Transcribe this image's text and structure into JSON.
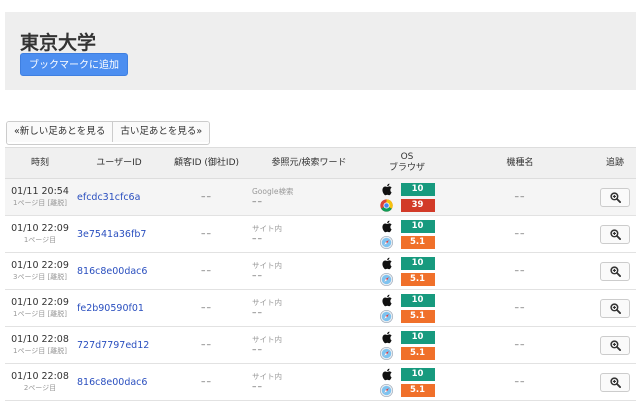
{
  "header": {
    "title": "東京大学",
    "bookmark_label": "ブックマークに追加"
  },
  "pager": {
    "newer_label": "«新しい足あとを見る",
    "older_label": "古い足あとを見る»"
  },
  "table": {
    "headers": {
      "time": "時刻",
      "user_id": "ユーザーID",
      "customer_id": "顧客ID (御社ID)",
      "referrer": "参照元/検索ワード",
      "os": "OS",
      "browser": "ブラウザ",
      "model": "機種名",
      "track": "追跡"
    },
    "rows": [
      {
        "time": "01/11 20:54",
        "visit": "1ページ目 [離脱]",
        "user_id": "efcdc31cfc6a",
        "customer_id": "––",
        "ref_label": "Google検索",
        "ref_value": "––",
        "os_icon": "apple-icon",
        "os_version": "10",
        "browser_icon": "chrome-icon",
        "browser_version": "39",
        "model": "––"
      },
      {
        "time": "01/10 22:09",
        "visit": "1ページ目",
        "user_id": "3e7541a36fb7",
        "customer_id": "––",
        "ref_label": "サイト内",
        "ref_value": "––",
        "os_icon": "apple-icon",
        "os_version": "10",
        "browser_icon": "safari-icon",
        "browser_version": "5.1",
        "model": "––"
      },
      {
        "time": "01/10 22:09",
        "visit": "3ページ目 [離脱]",
        "user_id": "816c8e00dac6",
        "customer_id": "––",
        "ref_label": "サイト内",
        "ref_value": "––",
        "os_icon": "apple-icon",
        "os_version": "10",
        "browser_icon": "safari-icon",
        "browser_version": "5.1",
        "model": "––"
      },
      {
        "time": "01/10 22:09",
        "visit": "1ページ目 [離脱]",
        "user_id": "fe2b90590f01",
        "customer_id": "––",
        "ref_label": "サイト内",
        "ref_value": "––",
        "os_icon": "apple-icon",
        "os_version": "10",
        "browser_icon": "safari-icon",
        "browser_version": "5.1",
        "model": "––"
      },
      {
        "time": "01/10 22:08",
        "visit": "1ページ目 [離脱]",
        "user_id": "727d7797ed12",
        "customer_id": "––",
        "ref_label": "サイト内",
        "ref_value": "––",
        "os_icon": "apple-icon",
        "os_version": "10",
        "browser_icon": "safari-icon",
        "browser_version": "5.1",
        "model": "––"
      },
      {
        "time": "01/10 22:08",
        "visit": "2ページ目",
        "user_id": "816c8e00dac6",
        "customer_id": "––",
        "ref_label": "サイト内",
        "ref_value": "––",
        "os_icon": "apple-icon",
        "os_version": "10",
        "browser_icon": "safari-icon",
        "browser_version": "5.1",
        "model": "––"
      }
    ]
  },
  "colors": {
    "bookmark_button": "#4c8ef0",
    "os_badge": "#179a7e",
    "chrome_badge": "#d23a28",
    "safari_badge": "#f0702a",
    "user_link": "#2a4fbf"
  }
}
